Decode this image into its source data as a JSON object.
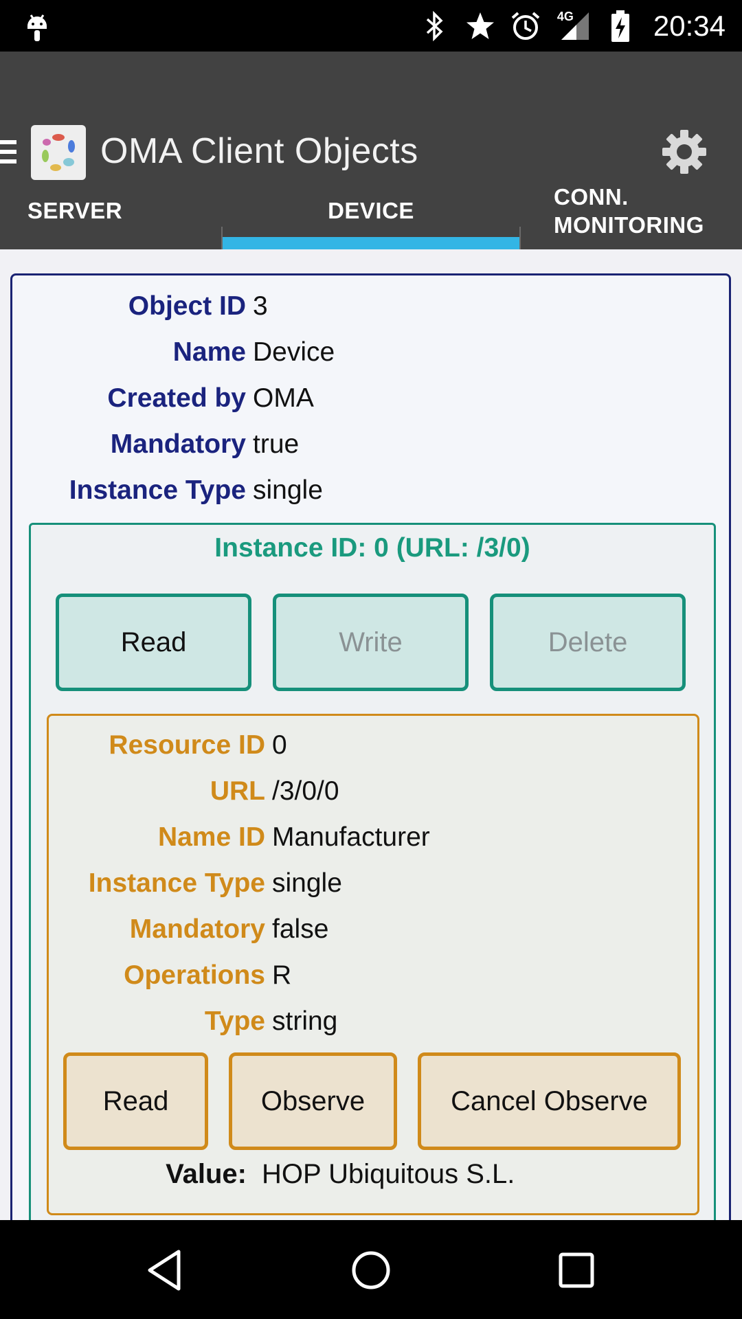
{
  "status_bar": {
    "time": "20:34",
    "network": "4G",
    "icons": [
      "android-notification-icon",
      "bluetooth-icon",
      "star-icon",
      "alarm-icon",
      "signal-icon",
      "battery-charging-icon"
    ]
  },
  "app_bar": {
    "title": "OMA Client Objects",
    "icons": [
      "menu-icon",
      "app-logo",
      "settings-gear-icon"
    ]
  },
  "tabs": [
    {
      "label": "SERVER",
      "selected": false
    },
    {
      "label": "DEVICE",
      "selected": true
    },
    {
      "label_line1": "CONN.",
      "label_line2": "MONITORING",
      "selected": false
    }
  ],
  "object": {
    "rows": [
      {
        "label": "Object ID",
        "value": "3"
      },
      {
        "label": "Name",
        "value": "Device"
      },
      {
        "label": "Created by",
        "value": "OMA"
      },
      {
        "label": "Mandatory",
        "value": "true"
      },
      {
        "label": "Instance Type",
        "value": "single"
      }
    ]
  },
  "instance": {
    "title": "Instance ID: 0 (URL: /3/0)",
    "buttons": {
      "read": "Read",
      "write": "Write",
      "delete": "Delete"
    }
  },
  "resource": {
    "rows": [
      {
        "label": "Resource ID",
        "value": "0"
      },
      {
        "label": "URL",
        "value": "/3/0/0"
      },
      {
        "label": "Name ID",
        "value": "Manufacturer"
      },
      {
        "label": "Instance Type",
        "value": "single"
      },
      {
        "label": "Mandatory",
        "value": "false"
      },
      {
        "label": "Operations",
        "value": "R"
      },
      {
        "label": "Type",
        "value": "string"
      }
    ],
    "buttons": {
      "read": "Read",
      "observe": "Observe",
      "cancel_observe": "Cancel Observe"
    },
    "value_label": "Value:",
    "value": "HOP Ubiquitous S.L."
  },
  "colors": {
    "app_bar": "#424242",
    "tab_indicator": "#33b5e5",
    "object_label": "#1a237e",
    "instance_accent": "#16907a",
    "resource_accent": "#d08a1a"
  }
}
